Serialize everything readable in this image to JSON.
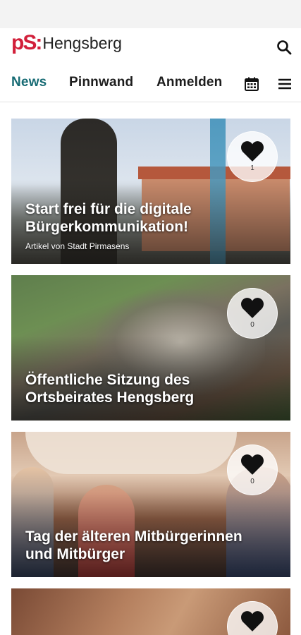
{
  "brand": {
    "mark": "pS",
    "colon": ":",
    "town": "Hengsberg"
  },
  "nav": {
    "tabs": [
      {
        "label": "News",
        "active": true
      },
      {
        "label": "Pinnwand",
        "active": false
      },
      {
        "label": "Anmelden",
        "active": false
      }
    ],
    "icons": [
      "calendar-icon",
      "menu-icon"
    ]
  },
  "articles": [
    {
      "title": "Start frei für die digitale Bürgerkommunikation!",
      "subtitle": "Artikel von Stadt Pirmasens",
      "likes": "1"
    },
    {
      "title": "Öffentliche Sitzung des Ortsbeirates Hengsberg",
      "subtitle": "",
      "likes": "0"
    },
    {
      "title": "Tag der älteren Mitbürgerinnen und Mitbürger",
      "subtitle": "",
      "likes": "0"
    },
    {
      "title": "",
      "subtitle": "",
      "likes": ""
    }
  ],
  "colors": {
    "accent": "#176b74",
    "brand_red": "#d21f3a"
  }
}
